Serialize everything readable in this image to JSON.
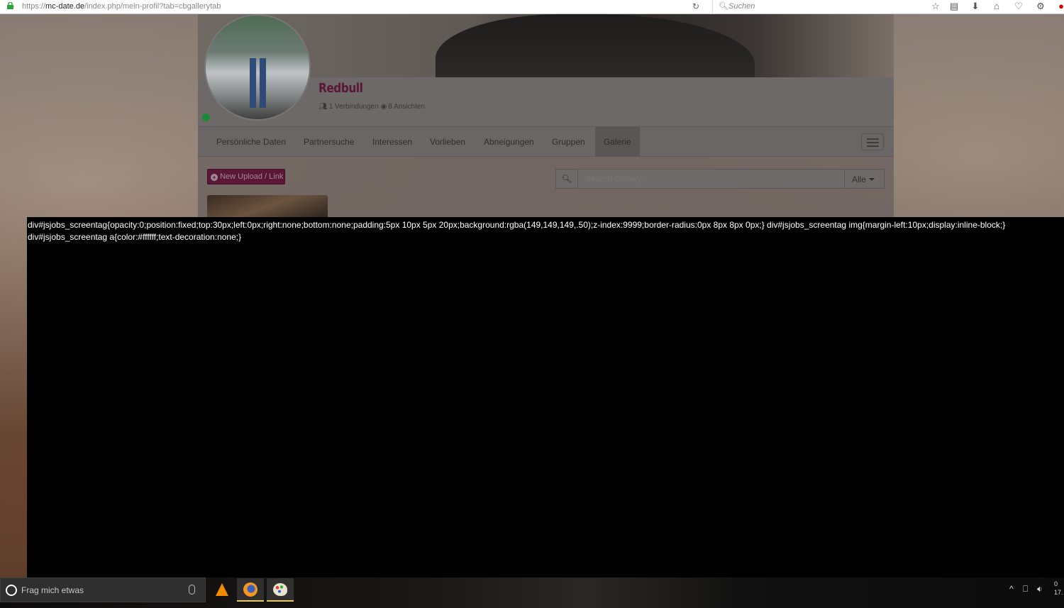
{
  "browser": {
    "url_prefix": "https://",
    "url_host": "mc-date.de",
    "url_path": "/index.php/mein-profil?tab=cbgallerytab",
    "search_placeholder": "Suchen"
  },
  "profile": {
    "username": "Redbull",
    "stats": "1 Verbindungen",
    "views": "8 Ansichten",
    "online_status_color": "#1b8a33"
  },
  "nav": {
    "tabs": [
      {
        "label": "Persönliche Daten"
      },
      {
        "label": "Partnersuche"
      },
      {
        "label": "Interessen"
      },
      {
        "label": "Vorlieben"
      },
      {
        "label": "Abneigungen"
      },
      {
        "label": "Gruppen"
      },
      {
        "label": "Galerie",
        "active": true
      }
    ]
  },
  "gallery": {
    "upload_label": "New Upload / Link",
    "search_placeholder": "Search Gallery...",
    "filter_label": "Alle"
  },
  "overlay": {
    "code_text": "div#jsjobs_screentag{opacity:0;position:fixed;top:30px;left:0px;right:none;bottom:none;padding:5px 10px 5px 20px;background:rgba(149,149,149,.50);z-index:9999;border-radius:0px 8px 8px 0px;} div#jsjobs_screentag img{margin-left:10px;display:inline-block;} div#jsjobs_screentag a{color:#ffffff;text-decoration:none;}"
  },
  "taskbar": {
    "search_placeholder": "Frag mich etwas",
    "apps": [
      "vlc-icon",
      "firefox-icon",
      "paint-icon"
    ],
    "clock_time": "0",
    "clock_date": "17."
  },
  "colors": {
    "accent": "#5c1636",
    "overlay_bg": "#000000"
  }
}
